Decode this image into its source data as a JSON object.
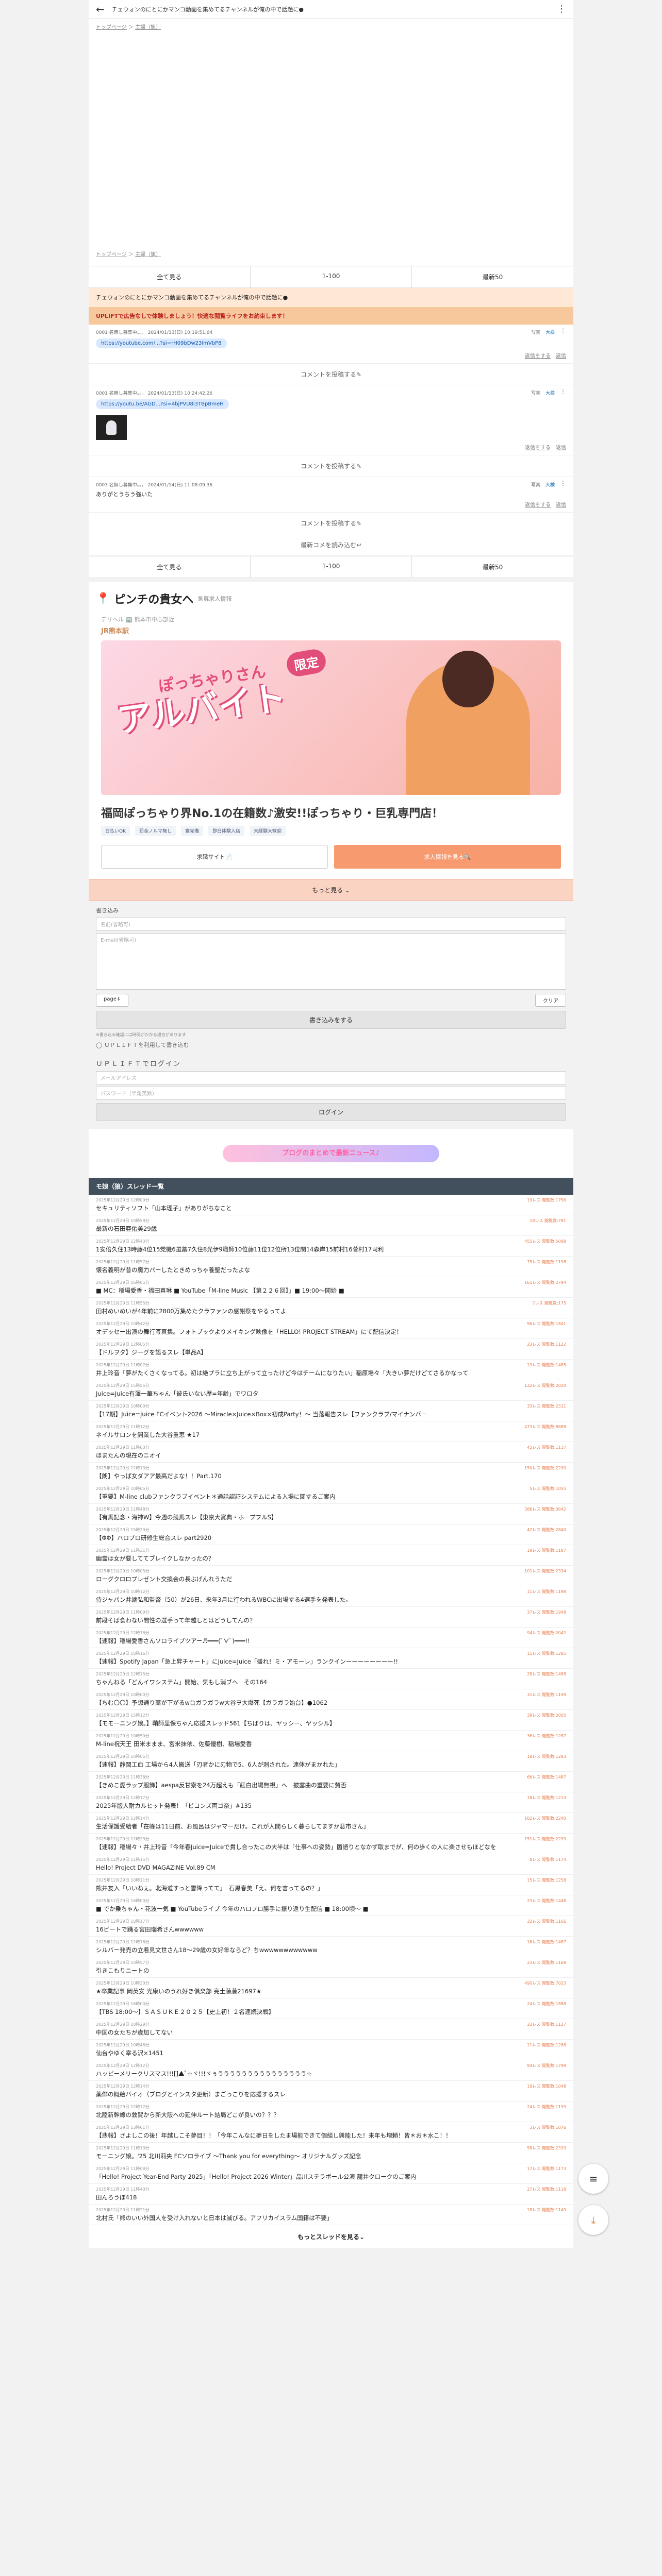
{
  "topbar": {
    "title": "チェウォンのにとにかマンコ動画を集めてるチャンネルが俺の中で話題に●"
  },
  "breadcrumb": {
    "top": "トップページ",
    "sep": "＞",
    "cur": "主婦（旗）"
  },
  "nav": {
    "all": "全て見る",
    "range": "1-100",
    "latest": "最新50"
  },
  "thread_title": "チェウォンのにとにかマンコ動画を集めてるチャンネルが俺の中で話題に●",
  "notice": "UPLIFTで広告なしで体験しましょう！快適な閲覧ライフをお約束します！",
  "posts": [
    {
      "head": "0001 名無し募集中。。。 2024/01/13(日) 10:19:51.64",
      "actions": [
        "写真",
        "大検",
        "⋮"
      ],
      "link": "https://youtube.com/...?si=rH09bDw23lmVbP8",
      "body": "",
      "thumb": false,
      "foot": [
        "返信をする",
        "返信"
      ]
    },
    {
      "head": "0001 名無し募集中。。。 2024/01/13(日) 10:24:42.26",
      "actions": [
        "写真",
        "大検",
        "⋮"
      ],
      "link": "https://youtu.be/AGD...?si=4bjPVU8i3TBpBmeH",
      "body": "",
      "thumb": true,
      "foot": [
        "返信をする",
        "返信"
      ]
    },
    {
      "head": "0003 名無し募集中。。。 2024/01/14(日) 11:08:09.36",
      "actions": [
        "写真",
        "大検",
        "⋮"
      ],
      "link": "",
      "body": "ありがとうちう強いた",
      "thumb": false,
      "foot": [
        "返信をする",
        "返信"
      ]
    }
  ],
  "comment_label": "コメントを投稿する✎",
  "read_all": "最新コメを読み込む↩",
  "shop": {
    "name": "ピンチの貴女へ",
    "sub": "急募求人情報",
    "area": "デリヘル 🏢 熊本市中心部近",
    "station": "JR熊本駅",
    "badge": "限定",
    "logo_small": "ぽっちゃりさん",
    "logo_big": "アルバイト",
    "title": "福岡ぽっちゃり界No.1の在籍数♪激安!!ぽっちゃり・巨乳専門店！",
    "tags": [
      "日払いOK",
      "罰金ノルマ無し",
      "寮完備",
      "即日体験入店",
      "未経験大歓迎"
    ],
    "btn_site": "求職サイト📄",
    "btn_call": "求人情報を見る🔍"
  },
  "more_label": "もっと見る ⌄",
  "form": {
    "label": "書き込み",
    "name_ph": "名前(省略可)",
    "mail_ph": "E-mail(省略可)",
    "page_btn": "page⇓",
    "clear_btn": "クリア",
    "submit": "書き込みをする",
    "note": "※書き込み確認には時間がかかる場合があります",
    "uplift_chk": "◯ ＵＰＬＩＦＴを利用して書き込む",
    "uplift_title": "ＵＰＬＩＦＴでログイン",
    "mail": "メールアドレス",
    "pass": "パスワード（半角英数）",
    "login": "ログイン"
  },
  "promo": "ブログのまとめで最新ニュース♪",
  "thread_head": "モ娘（狼）スレッド一覧",
  "threads": [
    {
      "d": "2025年12月29日 12時00分",
      "r": "19レス",
      "v": "閲覧数:1756",
      "t": "セキュリティソフト「山本理子」がありがちなこと"
    },
    {
      "d": "2025年12月29日 10時59分",
      "r": "18レス",
      "v": "閲覧数:781",
      "t": "最新の石田亜佑美29歳"
    },
    {
      "d": "2025年12月29日 12時43分",
      "r": "455レス",
      "v": "閲覧数:5098",
      "t": "1安倍久住13時藤4位15党機6選藁7久住8光伊9職師10位藤11位12位所13位関14森岸15前村16菅村17司利"
    },
    {
      "d": "2025年12月29日 11時57分",
      "r": "75レス",
      "v": "閲覧数:1198",
      "t": "懐名義明が昔の魔力パーしたときめっちゃ養聖だったよな"
    },
    {
      "d": "2025年12月29日 16時05分",
      "r": "161レス",
      "v": "閲覧数:2794",
      "t": "■ MC：稲場愛香・福田真琳 ■ YouTube「M-line Music 【第２２６回】」■ 19:00〜開始 ■"
    },
    {
      "d": "2025年12月29日 11時55分",
      "r": "7レス",
      "v": "閲覧数:175",
      "t": "田村めいめいが4年前に2800万集めたクラファンの感謝祭をやるってよ"
    },
    {
      "d": "2025年12月29日 10時42分",
      "r": "96レス",
      "v": "閲覧数:1841",
      "t": "オデッセー出演の舞行写真集。フォトブックよりメイキング映像を「HELLO! PROJECT STREAM」にて配信決定！"
    },
    {
      "d": "2025年12月29日 12時05分",
      "r": "23レス",
      "v": "閲覧数:1122",
      "t": "【ドルヲタ】ジーグを語るスレ【単品A】"
    },
    {
      "d": "2025年12月29日 11時07分",
      "r": "19レス",
      "v": "閲覧数:1485",
      "t": "井上玲音「夢がたくさくなってる。初は絶プラに立ち上がって立ったけど今はチームになりたい」稲原場々「大きい夢だけどてさるかなって"
    },
    {
      "d": "2025年12月29日 15時55分",
      "r": "122レス",
      "v": "閲覧数:2020",
      "t": "Juice=Juice有澤一華ちゃん「彼氏いない歴=年齢」でワロタ"
    },
    {
      "d": "2025年12月29日 10時00分",
      "r": "33レス",
      "v": "閲覧数:2311",
      "t": "【17期】Juice=Juice FCイベント2026 〜Miracle×Juice×Box×初成Party！〜 当落報告スレ【ファンクラブ/マイナンバー"
    },
    {
      "d": "2025年12月29日 11時12分",
      "r": "473レス",
      "v": "閲覧数:8888",
      "t": "ネイルサロンを開業した大谷重恵 ★17"
    },
    {
      "d": "2025年12月29日 11時03分",
      "r": "45レス",
      "v": "閲覧数:1117",
      "t": "ほまたんの現在のニオイ"
    },
    {
      "d": "2025年12月29日 12時13分",
      "r": "150レス",
      "v": "閲覧数:2290",
      "t": "【朗】やっぱ女ダアア最高だよな！！Part.170"
    },
    {
      "d": "2025年12月29日 10時05分",
      "r": "5レス",
      "v": "閲覧数:1055",
      "t": "【重要】M-line clubファンクラブイベント＊通話認証システムによる入場に関するご案内"
    },
    {
      "d": "2025年12月29日 11時48分",
      "r": "386レス",
      "v": "閲覧数:3842",
      "t": "【有馬記念・海神W】今週の競馬スレ【東京大賞典・ホープフルS】"
    },
    {
      "d": "2025年12月29日 15時20分",
      "r": "42レス",
      "v": "閲覧数:2840",
      "t": "【ΦΦ】ハロプロ研修生総合スレ part2920"
    },
    {
      "d": "2025年12月29日 11時31分",
      "r": "18レス",
      "v": "閲覧数:1187",
      "t": "幽霊は女が要しててブレイクしなかったの？"
    },
    {
      "d": "2025年12月29日 10時05分",
      "r": "101レス",
      "v": "閲覧数:2334",
      "t": "ローグクロロプレゼント交換会の長ぶげんれうただ"
    },
    {
      "d": "2025年12月29日 10時12分",
      "r": "11レス",
      "v": "閲覧数:1198",
      "t": "侍ジャパン井端弘和監督（50）が26日、来年3月に行われるWBCに出場する4選手を発表した。"
    },
    {
      "d": "2025年12月29日 11時09分",
      "r": "37レス",
      "v": "閲覧数:1948",
      "t": "前段そば食わない間性の選手って年越しとはどうしてんの？"
    },
    {
      "d": "2025年12月29日 12時18分",
      "r": "94レス",
      "v": "閲覧数:2042",
      "t": "【速報】稲場愛香さんソロライブツアー♬━━━(ﾟ∀ﾟ)━━━!!"
    },
    {
      "d": "2025年12月29日 10時16分",
      "r": "11レス",
      "v": "閲覧数:1285",
      "t": "【速報】Spotify Japan「急上昇チャート」にJuice=Juice「盛れ！ミ・アモーレ」ランクインーーーーーーーー!!"
    },
    {
      "d": "2025年12月29日 12時15分",
      "r": "28レス",
      "v": "閲覧数:1488",
      "t": "ちゃんねる「どんイワシステム」開始、気もし消ブへ　その164"
    },
    {
      "d": "2025年12月29日 10時00分",
      "r": "31レス",
      "v": "閲覧数:1199",
      "t": "【ちむ〇〇】予想通り藁が下がるw台ガラガラw大谷ヲ大爆死【ガラガラ始台】●1062"
    },
    {
      "d": "2025年12月29日 15時12分",
      "r": "38レス",
      "v": "閲覧数:2005",
      "t": "【モモーニング娘。】鞘師里保ちゃん応援スレッド561【ちばりは、ヤッシー、ヤッシル】"
    },
    {
      "d": "2025年12月29日 10時50分",
      "r": "36レス",
      "v": "閲覧数:1287",
      "t": "M-line祝天王 田米ままま、宮米抹依、佐藤優樹、稲場愛香"
    },
    {
      "d": "2025年12月29日 10時05分",
      "r": "18レス",
      "v": "閲覧数:1283",
      "t": "【速報】静岡工血 工場から4人搬送「刃者かに刃物で5、6人が刺された。連体がまかれた」"
    },
    {
      "d": "2025年12月29日 11時38分",
      "r": "66レス",
      "v": "閲覧数:1487",
      "t": "【きめこ愛ラップ服飾】aespa反甘寮を24万超えも「紅白出場無視」へ　披露曲の重要に賛否"
    },
    {
      "d": "2025年12月29日 12時17分",
      "r": "18レス",
      "v": "閲覧数:1213",
      "t": "2025年版人耐カルヒット発表！「ビコンズ両ゴ奈」#135"
    },
    {
      "d": "2025年12月29日 12時14分",
      "r": "102レス",
      "v": "閲覧数:2240",
      "t": "生活保護受給者「在峰は11日前、お風呂はジャマーだけ。これが人間らしく暮らしてますか悲市さん」"
    },
    {
      "d": "2025年12月29日 12時23分",
      "r": "151レス",
      "v": "閲覧数:2299",
      "t": "【速報】稲場々・井上玲音「今年春Juice=Juiceで貫し合ったこの大半は「仕事への姿勢」箇語りとなかず取までが、何の歩くの人に楽させもほどなを"
    },
    {
      "d": "2025年12月29日 11時15分",
      "r": "8レス",
      "v": "閲覧数:1174",
      "t": "Hello! Project DVD MAGAZINE Vol.89 CM"
    },
    {
      "d": "2025年12月29日 10時11分",
      "r": "15レス",
      "v": "閲覧数:1258",
      "t": "熊井友入「いいねぇ。北海道すっと雪降ってて」　石黒春美「え、何を言ってるの？」"
    },
    {
      "d": "2025年12月29日 16時00分",
      "r": "23レス",
      "v": "閲覧数:1448",
      "t": "■ でか乗ちゃん・花波一気 ■ YouTubeライブ 今年のハロプロ勝手に振り返り生配信 ■ 18:00頃〜 ■"
    },
    {
      "d": "2025年12月29日 10時17分",
      "r": "32レス",
      "v": "閲覧数:1166",
      "t": "16ビートで踊る宮田瑞希さんwwwwww"
    },
    {
      "d": "2025年12月29日 12時16分",
      "r": "16レス",
      "v": "閲覧数:1487",
      "t": "シルバー発売の立着見文世さん18〜29歳の女好年ならど？ちwwwwwwwwwwww"
    },
    {
      "d": "2025年12月29日 10時57分",
      "r": "23レス",
      "v": "閲覧数:1168",
      "t": "引きこもりニートの"
    },
    {
      "d": "2025年12月29日 10時30分",
      "r": "490レス",
      "v": "閲覧数:7023",
      "t": "★卒業記事 岡英安 光康いのうれ好き倶楽部 亮土藤藤21697★"
    },
    {
      "d": "2025年12月29日 16時00分",
      "r": "24レス",
      "v": "閲覧数:1888",
      "t": "【TBS 18:00〜】ＳＡＳＵＫＥ２０２５【史上初！２名連続決戦】"
    },
    {
      "d": "2025年12月29日 10時29分",
      "r": "33レス",
      "v": "閲覧数:1127",
      "t": "中国の女たちが歳加してない"
    },
    {
      "d": "2025年12月29日 10時46分",
      "r": "11レス",
      "v": "閲覧数:1288",
      "t": "仙台やゆく宰る沢×1451"
    },
    {
      "d": "2025年12月29日 12時12分",
      "r": "94レス",
      "v": "閲覧数:1799",
      "t": "ハッピーメリークリスマス!!![]▲ﾟ☆ゞ!!!ゞぅううううううううううううううう☆"
    },
    {
      "d": "2025年12月29日 12時14分",
      "r": "19レス",
      "v": "閲覧数:1048",
      "t": "薬俳の概絵バイオ（ブログとインスタ更新）まごっこりを応援するスレ"
    },
    {
      "d": "2025年12月29日 12時17分",
      "r": "24レス",
      "v": "閲覧数:1199",
      "t": "北陸新幹線の敦賀から新大阪への延伸ルート結局どこが良いの？？？"
    },
    {
      "d": "2025年12月29日 13時01分",
      "r": "3レス",
      "v": "閲覧数:1076",
      "t": "【悲報】さよしこの後！年越しこそ夢目！！「今年こんなに夢日をしたま場能できて個組し興能した！来年も増頼！皆＊お＊水こ！！"
    },
    {
      "d": "2025年12月29日 11時13分",
      "r": "58レス",
      "v": "閲覧数:2333",
      "t": "モーニング娘。'25 北川莉央 FCソロライブ 〜Thank you for everything〜 オリジナルグッズ記念"
    },
    {
      "d": "2025年12月29日 11時08分",
      "r": "17レス",
      "v": "閲覧数:1173",
      "t": "「Hello! Project Year-End Party 2025」「Hello! Project 2026 Winter」品川ステラボール公演 龍井クロークのご案内"
    },
    {
      "d": "2025年12月29日 11時40分",
      "r": "27レス",
      "v": "閲覧数:1118",
      "t": "田んろうぼ418"
    },
    {
      "d": "2025年12月29日 11時21分",
      "r": "18レス",
      "v": "閲覧数:1149",
      "t": "北村氏「熊のいい外国人を受け入れないと日本は滅びる。アフリカイスラム国籍は不要」"
    }
  ],
  "more_threads": "もっとスレッドを見る⌄",
  "fab": {
    "a": "≡",
    "b": "⤓"
  }
}
